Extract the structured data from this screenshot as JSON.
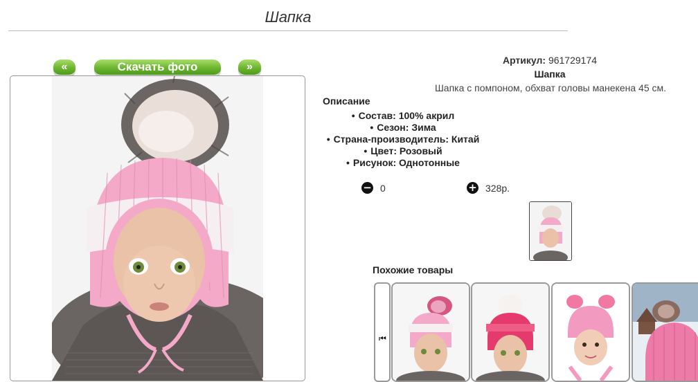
{
  "page": {
    "title": "Шапка"
  },
  "gallery": {
    "prev_label": "«",
    "download_label": "Скачать фото",
    "next_label": "»"
  },
  "product": {
    "sku_label": "Артикул:",
    "sku_value": "961729174",
    "name": "Шапка",
    "description": "Шапка с помпоном, обхват головы манекена 45 см.",
    "description_heading": "Описание",
    "specs": [
      "Состав: 100% акрил",
      "Сезон: Зима",
      "Страна-производитель: Китай",
      "Цвет: Розовый",
      "Рисунок: Однотонные"
    ],
    "quantity": "0",
    "price": "328р."
  },
  "similar": {
    "heading": "Похожие товары"
  },
  "icons": {
    "minus": "minus-circle-icon",
    "plus": "plus-circle-icon",
    "carousel_prev": "skip-back-icon"
  },
  "colors": {
    "button_green": "#6cb52f",
    "hat_pink": "#f4a9c8",
    "hat_white": "#f3eef0"
  }
}
